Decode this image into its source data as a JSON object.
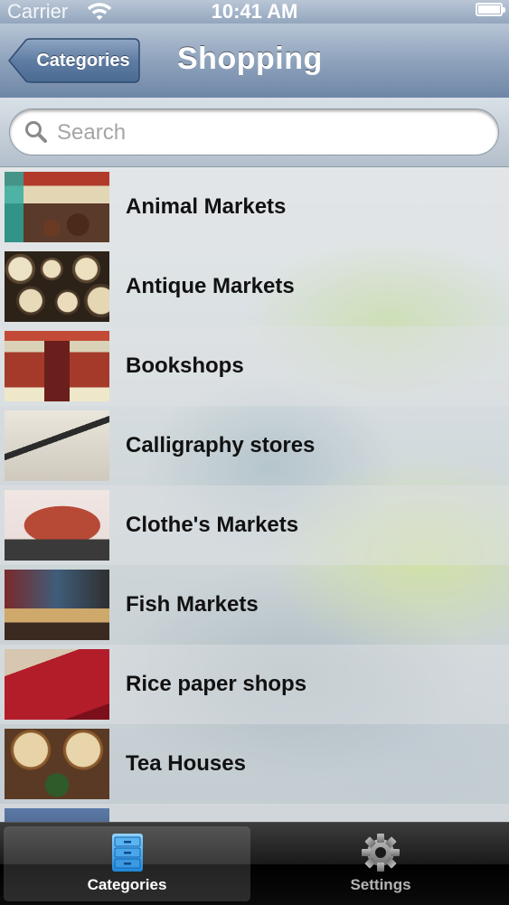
{
  "status_bar": {
    "carrier": "Carrier",
    "time": "10:41 AM"
  },
  "nav": {
    "back_label": "Categories",
    "title": "Shopping"
  },
  "search": {
    "placeholder": "Search"
  },
  "list": {
    "items": [
      {
        "label": "Animal Markets"
      },
      {
        "label": "Antique Markets"
      },
      {
        "label": "Bookshops"
      },
      {
        "label": "Calligraphy stores"
      },
      {
        "label": "Clothe's Markets"
      },
      {
        "label": "Fish Markets"
      },
      {
        "label": "Rice paper shops"
      },
      {
        "label": "Tea Houses"
      }
    ]
  },
  "tab_bar": {
    "tabs": [
      {
        "label": "Categories",
        "icon": "file-cabinet-icon",
        "selected": true
      },
      {
        "label": "Settings",
        "icon": "gear-icon",
        "selected": false
      }
    ]
  }
}
